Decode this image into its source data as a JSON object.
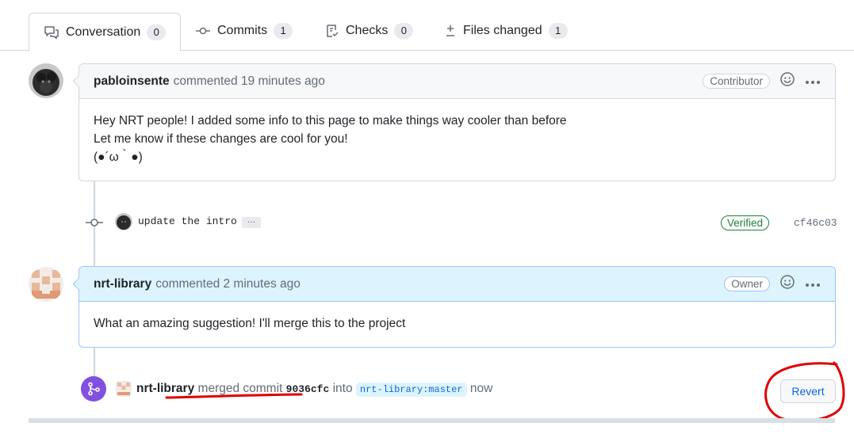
{
  "tabs": [
    {
      "label": "Conversation",
      "count": "0",
      "icon": "comment-discussion-icon",
      "selected": true
    },
    {
      "label": "Commits",
      "count": "1",
      "icon": "git-commit-icon"
    },
    {
      "label": "Checks",
      "count": "0",
      "icon": "checklist-icon"
    },
    {
      "label": "Files changed",
      "count": "1",
      "icon": "file-diff-icon"
    }
  ],
  "comment1": {
    "author": "pabloinsente",
    "meta": "commented 19 minutes ago",
    "role": "Contributor",
    "lines": [
      "Hey NRT people! I added some info to this page to make things way cooler than before",
      "Let me know if these changes are cool for you!",
      "(●´ω｀●)"
    ]
  },
  "commit": {
    "message": "update the intro",
    "ellipsis": "…",
    "verified": "Verified",
    "sha": "cf46c03"
  },
  "comment2": {
    "author": "nrt-library",
    "meta": "commented 2 minutes ago",
    "role": "Owner",
    "body": "What an amazing suggestion! I'll merge this to the project"
  },
  "merged": {
    "author": "nrt-library",
    "action": "merged commit",
    "sha": "9036cfc",
    "into": "into",
    "branch": "nrt-library:master",
    "when": "now",
    "revert_label": "Revert"
  },
  "colors": {
    "accent": "#0969da",
    "merged": "#8250df",
    "verified": "#1a7f37",
    "annotation": "#e00000"
  }
}
